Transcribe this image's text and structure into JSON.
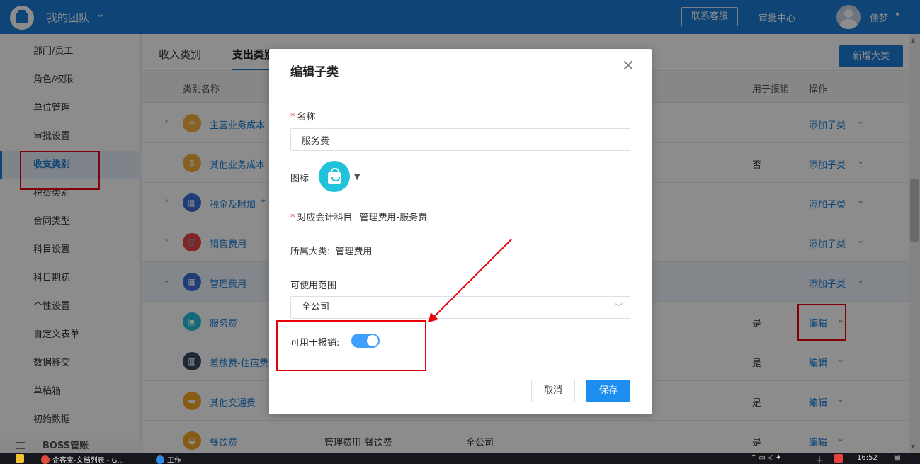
{
  "topbar": {
    "team_name": "我的团队",
    "team_chevron": "❯",
    "contact_label": "联系客服",
    "approval_label": "审批中心",
    "user_name": "佳梦"
  },
  "sidebar": {
    "items": [
      {
        "label": "部门/员工"
      },
      {
        "label": "角色/权限"
      },
      {
        "label": "单位管理"
      },
      {
        "label": "审批设置"
      },
      {
        "label": "收支类别"
      },
      {
        "label": "税费类别"
      },
      {
        "label": "合同类型"
      },
      {
        "label": "科目设置"
      },
      {
        "label": "科目期初"
      },
      {
        "label": "个性设置"
      },
      {
        "label": "自定义表单"
      },
      {
        "label": "数据移交"
      },
      {
        "label": "草稿箱"
      },
      {
        "label": "初始数据"
      }
    ],
    "active_index": 4,
    "section_label": "BOSS管账"
  },
  "main": {
    "tabs": [
      {
        "label": "收入类别"
      },
      {
        "label": "支出类别"
      }
    ],
    "new_category_label": "新增大类",
    "columns": {
      "name": "类别名称",
      "reimbursement": "用于报销",
      "action": "操作"
    },
    "rows": [
      {
        "name": "主营业务成本",
        "icon_color": "#f5b13d",
        "expand": "›",
        "subject": "",
        "scope": "",
        "reimbursement": "",
        "action": "添加子类"
      },
      {
        "name": "其他业务成本",
        "icon_color": "#f5b13d",
        "expand": "",
        "subject": "",
        "scope": "",
        "reimbursement": "否",
        "action": "添加子类"
      },
      {
        "name": "税金及附加",
        "icon_color": "#3b6fd6",
        "expand": "›",
        "subject": "",
        "scope": "",
        "reimbursement": "",
        "action": "添加子类"
      },
      {
        "name": "销售费用",
        "icon_color": "#e8423f",
        "expand": "›",
        "subject": "",
        "scope": "",
        "reimbursement": "",
        "action": "添加子类"
      },
      {
        "name": "管理费用",
        "icon_color": "#3b6fd6",
        "expand": "⌄",
        "subject": "",
        "scope": "",
        "reimbursement": "",
        "action": "添加子类"
      },
      {
        "name": "服务费",
        "icon_color": "#21c2dc",
        "expand": "",
        "subject": "",
        "scope": "",
        "reimbursement": "是",
        "action": "编辑"
      },
      {
        "name": "差旅费-住宿费",
        "icon_color": "#3b4a66",
        "expand": "",
        "subject": "",
        "scope": "",
        "reimbursement": "是",
        "action": "编辑"
      },
      {
        "name": "其他交通费",
        "icon_color": "#f5a623",
        "expand": "",
        "subject": "",
        "scope": "",
        "reimbursement": "是",
        "action": "编辑"
      },
      {
        "name": "餐饮费",
        "icon_color": "#f5a623",
        "expand": "",
        "subject": "管理费用-餐饮费",
        "scope": "全公司",
        "reimbursement": "是",
        "action": "编辑"
      }
    ]
  },
  "dialog": {
    "title": "编辑子类",
    "required_mark": "*",
    "name_label": "名称",
    "name_value": "服务费",
    "icon_label": "图标",
    "icon_color": "#21c2dc",
    "account_label": "对应会计科目",
    "account_value": "管理费用-服务费",
    "parent_label": "所属大类:",
    "parent_value": "管理费用",
    "scope_label": "可使用范围",
    "scope_value": "全公司",
    "reimbursable_label": "可用于报销:",
    "reimbursable_on": true,
    "cancel_label": "取消",
    "save_label": "保存"
  },
  "taskbar": {
    "item1": "企客宝-文档列表 - G...",
    "item2": "工作",
    "ime": "中",
    "clock": "16:52"
  },
  "colors": {
    "brand": "#1b7fd8",
    "annotation": "#e8000b"
  }
}
